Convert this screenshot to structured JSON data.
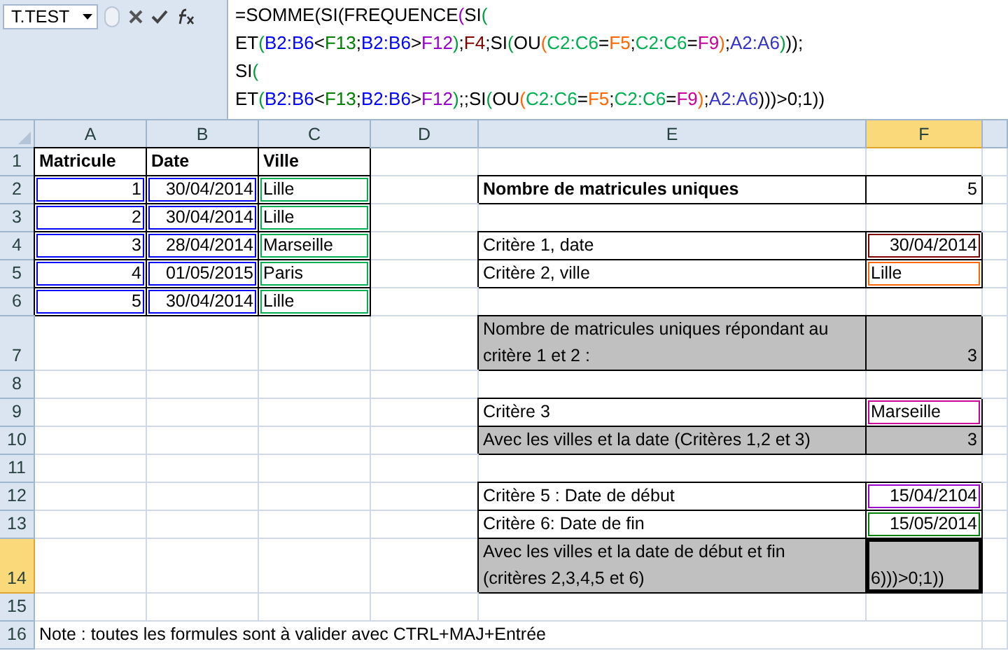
{
  "formula_bar": {
    "name_box": "T.TEST",
    "lines": [
      [
        {
          "text": "=SOMME(SI(FREQUENCE",
          "color": "#000000"
        },
        {
          "text": "(",
          "color": "#9900cc"
        },
        {
          "text": "SI",
          "color": "#000000"
        },
        {
          "text": "(",
          "color": "#00a040"
        }
      ],
      [
        {
          "text": "ET",
          "color": "#000000"
        },
        {
          "text": "(",
          "color": "#00a040"
        },
        {
          "text": "B2:B6",
          "color": "#0000ff"
        },
        {
          "text": "<",
          "color": "#000000"
        },
        {
          "text": "F13",
          "color": "#008000"
        },
        {
          "text": ";",
          "color": "#000000"
        },
        {
          "text": "B2:B6",
          "color": "#0000ff"
        },
        {
          "text": ">",
          "color": "#000000"
        },
        {
          "text": "F12",
          "color": "#9900cc"
        },
        {
          "text": ")",
          "color": "#00a040"
        },
        {
          "text": ";",
          "color": "#000000"
        },
        {
          "text": "F4",
          "color": "#800000"
        },
        {
          "text": ";SI",
          "color": "#000000"
        },
        {
          "text": "(",
          "color": "#00a040"
        },
        {
          "text": "OU",
          "color": "#000000"
        },
        {
          "text": "(",
          "color": "#ff6600"
        },
        {
          "text": "C2:C6",
          "color": "#00b050"
        },
        {
          "text": "=",
          "color": "#000000"
        },
        {
          "text": "F5",
          "color": "#ff6600"
        },
        {
          "text": ";",
          "color": "#000000"
        },
        {
          "text": "C2:C6",
          "color": "#00b050"
        },
        {
          "text": "=",
          "color": "#000000"
        },
        {
          "text": "F9",
          "color": "#cc0099"
        },
        {
          "text": ")",
          "color": "#ff6600"
        },
        {
          "text": ";",
          "color": "#000000"
        },
        {
          "text": "A2:A6",
          "color": "#3333cc"
        },
        {
          "text": ")",
          "color": "#00a040"
        },
        {
          "text": "));",
          "color": "#000000"
        }
      ],
      [
        {
          "text": "SI",
          "color": "#000000"
        },
        {
          "text": "(",
          "color": "#00a040"
        }
      ],
      [
        {
          "text": "ET",
          "color": "#000000"
        },
        {
          "text": "(",
          "color": "#00a040"
        },
        {
          "text": "B2:B6",
          "color": "#0000ff"
        },
        {
          "text": "<",
          "color": "#000000"
        },
        {
          "text": "F13",
          "color": "#008000"
        },
        {
          "text": ";",
          "color": "#000000"
        },
        {
          "text": "B2:B6",
          "color": "#0000ff"
        },
        {
          "text": ">",
          "color": "#000000"
        },
        {
          "text": "F12",
          "color": "#9900cc"
        },
        {
          "text": ")",
          "color": "#00a040"
        },
        {
          "text": ";;SI",
          "color": "#000000"
        },
        {
          "text": "(",
          "color": "#00a040"
        },
        {
          "text": "OU",
          "color": "#000000"
        },
        {
          "text": "(",
          "color": "#ff6600"
        },
        {
          "text": "C2:C6",
          "color": "#00b050"
        },
        {
          "text": "=",
          "color": "#000000"
        },
        {
          "text": "F5",
          "color": "#ff6600"
        },
        {
          "text": ";",
          "color": "#000000"
        },
        {
          "text": "C2:C6",
          "color": "#00b050"
        },
        {
          "text": "=",
          "color": "#000000"
        },
        {
          "text": "F9",
          "color": "#cc0099"
        },
        {
          "text": ")",
          "color": "#ff6600"
        },
        {
          "text": ";",
          "color": "#000000"
        },
        {
          "text": "A2:A6",
          "color": "#3333cc"
        },
        {
          "text": ")))>0;1))",
          "color": "#000000"
        }
      ]
    ]
  },
  "columns": [
    {
      "label": "A",
      "selected": false
    },
    {
      "label": "B",
      "selected": false
    },
    {
      "label": "C",
      "selected": false
    },
    {
      "label": "D",
      "selected": false
    },
    {
      "label": "E",
      "selected": false
    },
    {
      "label": "F",
      "selected": true
    }
  ],
  "rows": [
    {
      "number": "1",
      "selected": false,
      "cells": [
        {
          "kind": "text",
          "text": "Matricule",
          "bold": true,
          "bordered": true
        },
        {
          "kind": "text",
          "text": "Date",
          "bold": true,
          "bordered": true
        },
        {
          "kind": "text",
          "text": "Ville",
          "bold": true,
          "bordered": true
        }
      ]
    },
    {
      "number": "2",
      "selected": false,
      "cells": [
        {
          "kind": "number",
          "text": "1",
          "bordered": true,
          "color": "#0000ff"
        },
        {
          "kind": "number",
          "text": "30/04/2014",
          "bordered": true,
          "color": "#0000ff"
        },
        {
          "kind": "text",
          "text": "Lille",
          "bordered": true,
          "color": "#00b050"
        },
        {
          "kind": "blank"
        },
        {
          "kind": "text",
          "text": "Nombre de matricules uniques",
          "bold": true,
          "bordered": true
        },
        {
          "kind": "number",
          "text": "5",
          "bordered": true
        }
      ]
    },
    {
      "number": "3",
      "selected": false,
      "cells": [
        {
          "kind": "number",
          "text": "2",
          "bordered": true,
          "color": "#0000ff"
        },
        {
          "kind": "number",
          "text": "30/04/2014",
          "bordered": true,
          "color": "#0000ff"
        },
        {
          "kind": "text",
          "text": "Lille",
          "bordered": true,
          "color": "#00b050"
        }
      ]
    },
    {
      "number": "4",
      "selected": false,
      "cells": [
        {
          "kind": "number",
          "text": "3",
          "bordered": true,
          "color": "#0000ff"
        },
        {
          "kind": "number",
          "text": "28/04/2014",
          "bordered": true,
          "color": "#0000ff"
        },
        {
          "kind": "text",
          "text": "Marseille",
          "bordered": true,
          "color": "#00b050"
        },
        {
          "kind": "blank"
        },
        {
          "kind": "text",
          "text": "Critère 1, date",
          "bordered": true
        },
        {
          "kind": "number",
          "text": "30/04/2014",
          "bordered": true,
          "color": "#800000"
        }
      ]
    },
    {
      "number": "5",
      "selected": false,
      "cells": [
        {
          "kind": "number",
          "text": "4",
          "bordered": true,
          "color": "#0000ff"
        },
        {
          "kind": "number",
          "text": "01/05/2015",
          "bordered": true,
          "color": "#0000ff"
        },
        {
          "kind": "text",
          "text": "Paris",
          "bordered": true,
          "color": "#00b050"
        },
        {
          "kind": "blank"
        },
        {
          "kind": "text",
          "text": "Critère 2, ville",
          "bordered": true
        },
        {
          "kind": "text",
          "text": "Lille",
          "bordered": true,
          "color": "#ff6600"
        }
      ]
    },
    {
      "number": "6",
      "selected": false,
      "cells": [
        {
          "kind": "number",
          "text": "5",
          "bordered": true,
          "color": "#0000ff"
        },
        {
          "kind": "number",
          "text": "30/04/2014",
          "bordered": true,
          "color": "#0000ff"
        },
        {
          "kind": "text",
          "text": "Lille",
          "bordered": true,
          "color": "#00b050"
        }
      ]
    },
    {
      "number": "7",
      "selected": false,
      "cells": [
        {
          "kind": "blank"
        },
        {
          "kind": "blank"
        },
        {
          "kind": "blank"
        },
        {
          "kind": "blank"
        },
        {
          "kind": "text",
          "text": "Nombre de matricules uniques répondant au critère 1 et 2 :",
          "bordered": true,
          "shaded": true
        },
        {
          "kind": "number",
          "text": "3",
          "bordered": true,
          "shaded": true
        }
      ]
    },
    {
      "number": "8",
      "selected": false
    },
    {
      "number": "9",
      "selected": false,
      "cells": [
        {
          "kind": "blank"
        },
        {
          "kind": "blank"
        },
        {
          "kind": "blank"
        },
        {
          "kind": "blank"
        },
        {
          "kind": "text",
          "text": "Critère 3",
          "bordered": true
        },
        {
          "kind": "text",
          "text": "Marseille",
          "bordered": true,
          "color": "#cc0099"
        }
      ]
    },
    {
      "number": "10",
      "selected": false,
      "cells": [
        {
          "kind": "blank"
        },
        {
          "kind": "blank"
        },
        {
          "kind": "blank"
        },
        {
          "kind": "blank"
        },
        {
          "kind": "text",
          "text": "Avec les villes et la date (Critères 1,2 et 3)",
          "bordered": true,
          "shaded": true
        },
        {
          "kind": "number",
          "text": "3",
          "bordered": true,
          "shaded": true
        }
      ]
    },
    {
      "number": "11",
      "selected": false
    },
    {
      "number": "12",
      "selected": false,
      "cells": [
        {
          "kind": "blank"
        },
        {
          "kind": "blank"
        },
        {
          "kind": "blank"
        },
        {
          "kind": "blank"
        },
        {
          "kind": "text",
          "text": "Critère 5 : Date de début",
          "bordered": true
        },
        {
          "kind": "number",
          "text": "15/04/2104",
          "bordered": true,
          "color": "#9900cc"
        }
      ]
    },
    {
      "number": "13",
      "selected": false,
      "cells": [
        {
          "kind": "blank"
        },
        {
          "kind": "blank"
        },
        {
          "kind": "blank"
        },
        {
          "kind": "blank"
        },
        {
          "kind": "text",
          "text": "Critère 6: Date de fin",
          "bordered": true
        },
        {
          "kind": "number",
          "text": "15/05/2014",
          "bordered": true,
          "color": "#008000"
        }
      ]
    },
    {
      "number": "14",
      "selected": true,
      "cells": [
        {
          "kind": "blank"
        },
        {
          "kind": "blank"
        },
        {
          "kind": "blank"
        },
        {
          "kind": "blank"
        },
        {
          "kind": "text",
          "text": "Avec les villes et la date de début et fin (critères 2,3,4,5 et 6)",
          "bordered": true,
          "shaded": true
        },
        {
          "kind": "text",
          "text": "6)))>0;1))",
          "bordered": true,
          "shaded": true,
          "selected": true
        }
      ]
    },
    {
      "number": "15",
      "selected": false
    },
    {
      "number": "16",
      "selected": false,
      "cells": [
        {
          "kind": "text",
          "text": "Note : toutes les formules sont à valider avec CTRL+MAJ+Entrée",
          "bordered": false
        }
      ]
    }
  ]
}
